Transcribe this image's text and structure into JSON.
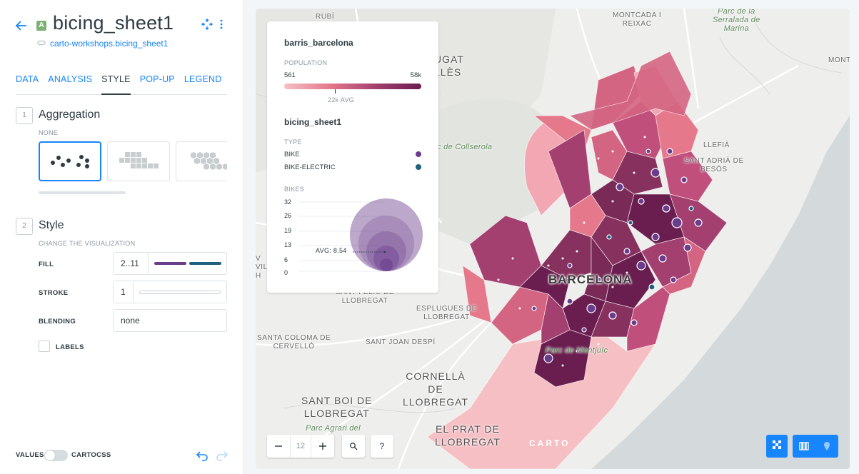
{
  "header": {
    "title": "bicing_sheet1",
    "type_badge": "A",
    "source": "carto-workshops.bicing_sheet1"
  },
  "tabs": [
    {
      "label": "DATA"
    },
    {
      "label": "ANALYSIS"
    },
    {
      "label": "STYLE"
    },
    {
      "label": "POP-UP"
    },
    {
      "label": "LEGEND"
    }
  ],
  "aggregation": {
    "step": "1",
    "title": "Aggregation",
    "selected": "NONE"
  },
  "style": {
    "step": "2",
    "title": "Style",
    "subtitle": "CHANGE THE VISUALIZATION",
    "fill_label": "FILL",
    "fill_value": "2..11",
    "fill_colors": [
      "#6a3d8c",
      "#1f6080"
    ],
    "stroke_label": "STROKE",
    "stroke_value": "1",
    "blending_label": "BLENDING",
    "blending_value": "none",
    "labels_label": "LABELS"
  },
  "footer": {
    "values_label": "VALUES",
    "cartocss_label": "CARTOCSS"
  },
  "legend": {
    "layer1_title": "barris_barcelona",
    "layer1_field": "POPULATION",
    "ramp_min": "561",
    "ramp_max": "58k",
    "ramp_avg": "22k AVG",
    "layer2_title": "bicing_sheet1",
    "type_label": "TYPE",
    "categories": [
      {
        "label": "BIKE",
        "color": "#6a3d8c"
      },
      {
        "label": "BIKE-ELECTRIC",
        "color": "#1f6080"
      }
    ],
    "bubble_field": "BIKES",
    "bubble_values": [
      "32",
      "26",
      "19",
      "13",
      "6",
      "0"
    ],
    "bubble_avg": "AVG: 8.54"
  },
  "map": {
    "zoom": "12",
    "help": "?",
    "brand": "CARTO",
    "places": {
      "rubi": "RUBÍ",
      "moncada": "MONTCADA I\nREIXAC",
      "serralada": "Parc de la\nSerralada de\nMarina",
      "sant_cugat": "UGAT\nLLÈS",
      "montgat": "MONTG",
      "collserola": "Parc de Collserola",
      "llefia": "LLEFIÀ",
      "sant_adria": "SANT ADRIÀ DE\nBESÒS",
      "vv": "V\nVILA\nH",
      "barcelona": "BARCELONA",
      "sant_feliu": "SANT FELIU DE\nLLOBREGAT",
      "esplugues": "ESPLUGUES DE\nLLOBREGAT",
      "santa_coloma": "SANTA COLOMA DE\nCERVELLÓ",
      "sant_joan": "SANT JOAN DESPÍ",
      "montjuic": "Parc de Montjuïc",
      "cornella": "CORNELLÀ\nDE\nLLOBREGAT",
      "sant_boi": "SANT BOI DE\nLLOBREGAT",
      "agrari": "Parc Agrari del",
      "prat": "EL PRAT DE\nLLOBREGAT"
    }
  }
}
